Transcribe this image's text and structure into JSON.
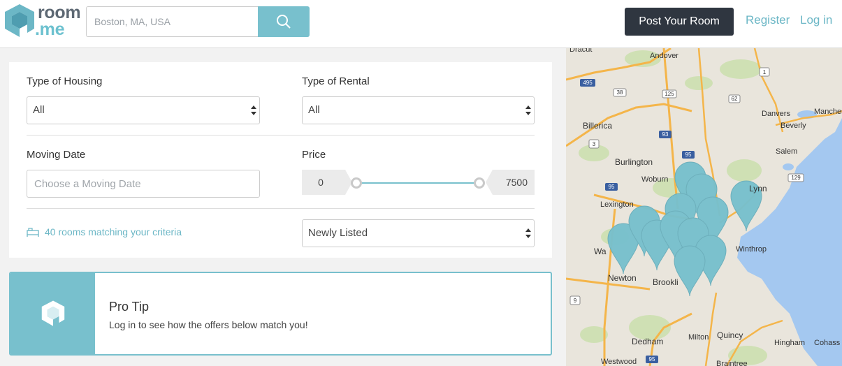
{
  "header": {
    "logo_lines": [
      "room",
      ".me"
    ],
    "search_placeholder": "Boston, MA, USA",
    "post_button": "Post Your Room",
    "register_link": "Register",
    "login_link": "Log in"
  },
  "filters": {
    "housing_label": "Type of Housing",
    "housing_value": "All",
    "rental_label": "Type of Rental",
    "rental_value": "All",
    "moving_label": "Moving Date",
    "moving_placeholder": "Choose a Moving Date",
    "price_label": "Price",
    "price_min": "0",
    "price_max": "7500",
    "matching_text": "40 rooms matching your criteria",
    "sort_value": "Newly Listed"
  },
  "protip": {
    "title": "Pro Tip",
    "text": "Log in to see how the offers below match you!"
  },
  "map": {
    "labels": [
      "Dracut",
      "Andover",
      "Billerica",
      "Danvers",
      "Manches",
      "Beverly",
      "Salem",
      "Burlington",
      "Woburn",
      "Lynn",
      "Lexington",
      "Winthrop",
      "Wa",
      "Newton",
      "Brookli",
      "Dedham",
      "Milton",
      "Quincy",
      "Hingham",
      "Cohass",
      "Westwood",
      "Braintree"
    ],
    "road_shields": [
      "495",
      "38",
      "125",
      "1",
      "62",
      "93",
      "3",
      "95",
      "129",
      "95",
      "9",
      "95"
    ],
    "pin_color": "#78c0cd",
    "water_color": "#a4c8f0"
  }
}
